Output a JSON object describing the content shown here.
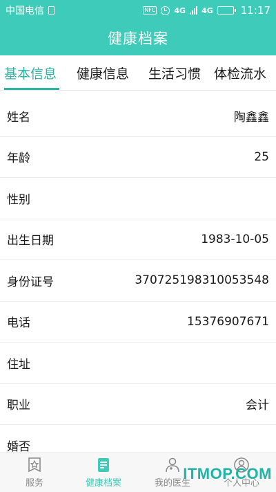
{
  "status_bar": {
    "carrier": "中国电信",
    "nfc": "NFC",
    "network_4g": "4G",
    "network_4g_secondary": "4G",
    "time": "11:17",
    "battery_level": 0.9
  },
  "header": {
    "title": "健康档案"
  },
  "tabs": [
    {
      "label": "基本信息",
      "active": true
    },
    {
      "label": "健康信息",
      "active": false
    },
    {
      "label": "生活习惯",
      "active": false
    },
    {
      "label": "体检流水",
      "active": false
    }
  ],
  "info_rows": [
    {
      "label": "姓名",
      "value": "陶鑫鑫"
    },
    {
      "label": "年龄",
      "value": "25"
    },
    {
      "label": "性别",
      "value": ""
    },
    {
      "label": "出生日期",
      "value": "1983-10-05"
    },
    {
      "label": "身份证号",
      "value": "370725198310053548"
    },
    {
      "label": "电话",
      "value": "15376907671"
    },
    {
      "label": "住址",
      "value": ""
    },
    {
      "label": "职业",
      "value": "会计"
    },
    {
      "label": "婚否",
      "value": ""
    }
  ],
  "bottom_nav": [
    {
      "label": "服务",
      "icon": "star-badge-icon",
      "active": false
    },
    {
      "label": "健康档案",
      "icon": "health-record-icon",
      "active": true
    },
    {
      "label": "我的医生",
      "icon": "doctor-icon",
      "active": false
    },
    {
      "label": "个人中心",
      "icon": "user-icon",
      "active": false
    }
  ],
  "watermark": "ITMOP.COM",
  "colors": {
    "primary": "#3fcbb9",
    "tab_active": "#2ab4a6",
    "nav_inactive": "#8a8a8a"
  }
}
